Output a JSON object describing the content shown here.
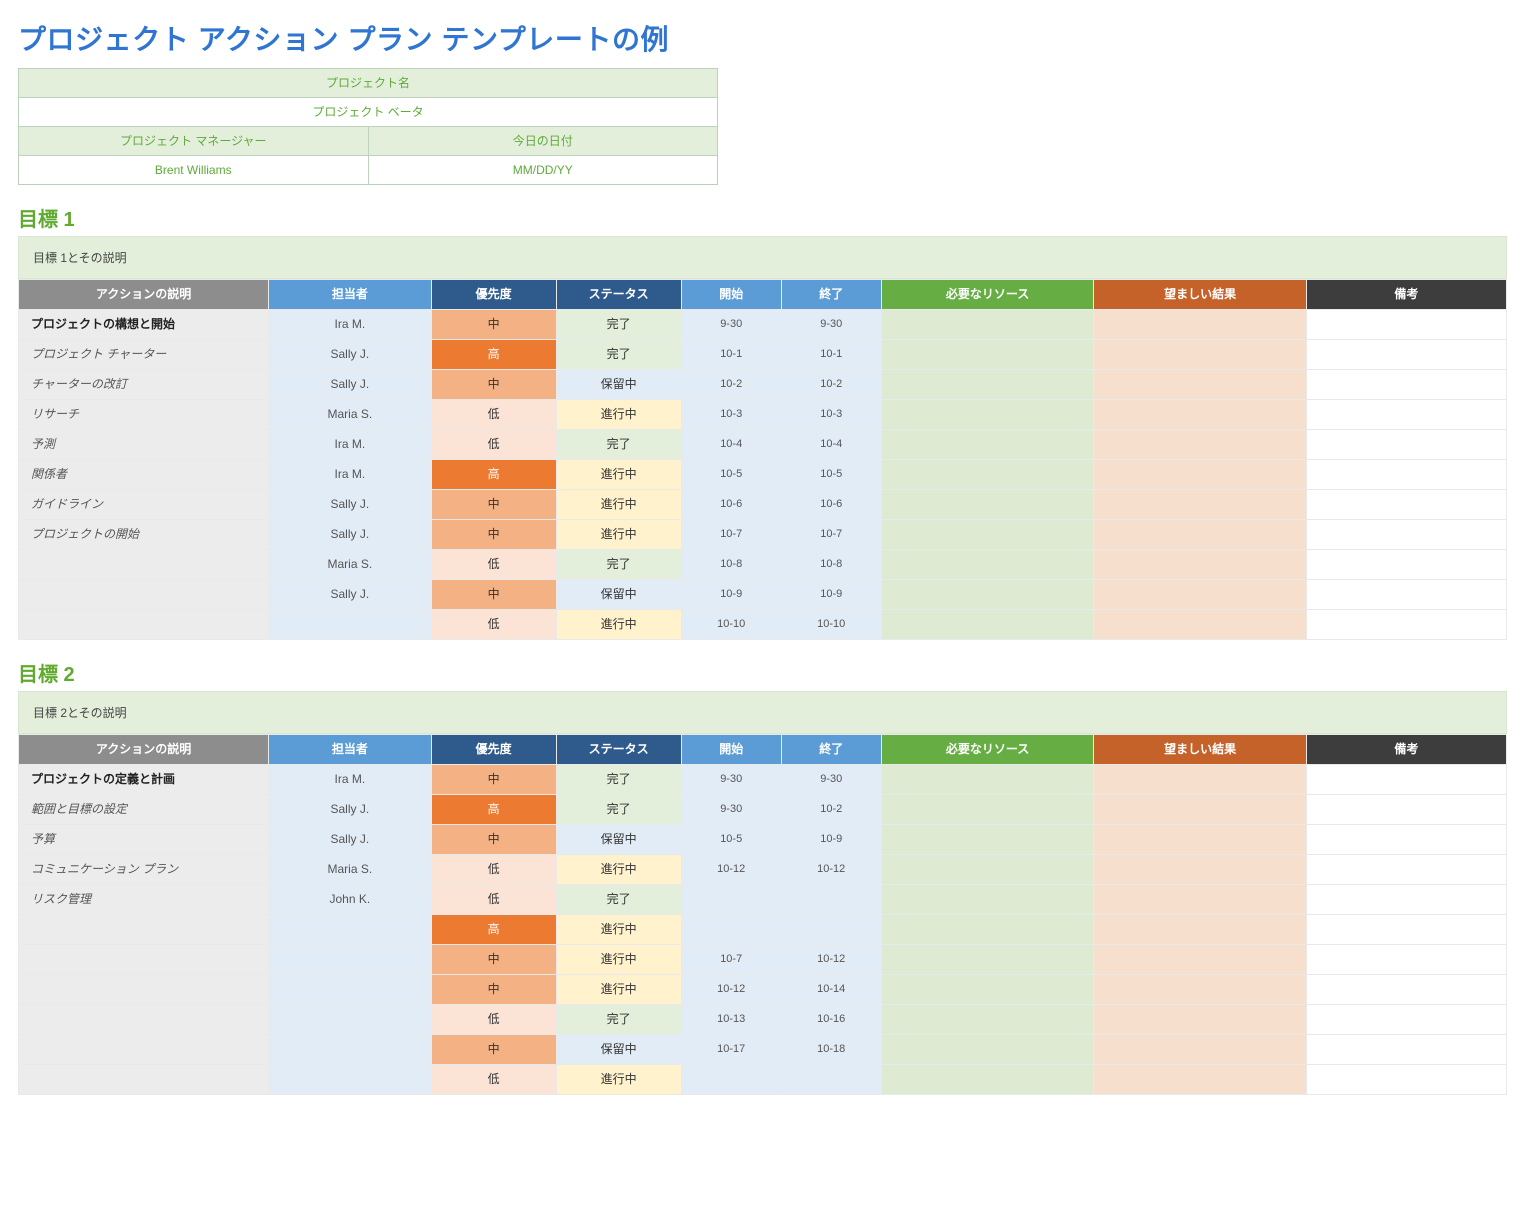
{
  "title": "プロジェクト アクション プラン テンプレートの例",
  "meta": {
    "project_label": "プロジェクト名",
    "project_value": "プロジェクト ベータ",
    "manager_label": "プロジェクト マネージャー",
    "manager_value": "Brent Williams",
    "date_label": "今日の日付",
    "date_value": "MM/DD/YY"
  },
  "columns": {
    "action": "アクションの説明",
    "owner": "担当者",
    "priority": "優先度",
    "status": "ステータス",
    "start": "開始",
    "end": "終了",
    "resource": "必要なリソース",
    "result": "望ましい結果",
    "note": "備考"
  },
  "priority_labels": {
    "high": "高",
    "med": "中",
    "low": "低"
  },
  "status_labels": {
    "done": "完了",
    "hold": "保留中",
    "prog": "進行中"
  },
  "goals": [
    {
      "heading": "目標 1",
      "desc": "目標 1とその説明",
      "rows": [
        {
          "action": "プロジェクトの構想と開始",
          "bold": true,
          "owner": "Ira M.",
          "priority": "med",
          "status": "done",
          "start": "9-30",
          "end": "9-30"
        },
        {
          "action": "プロジェクト チャーター",
          "owner": "Sally J.",
          "priority": "high",
          "status": "done",
          "start": "10-1",
          "end": "10-1"
        },
        {
          "action": "チャーターの改訂",
          "owner": "Sally J.",
          "priority": "med",
          "status": "hold",
          "start": "10-2",
          "end": "10-2"
        },
        {
          "action": "リサーチ",
          "owner": "Maria S.",
          "priority": "low",
          "status": "prog",
          "start": "10-3",
          "end": "10-3"
        },
        {
          "action": "予測",
          "owner": "Ira M.",
          "priority": "low",
          "status": "done",
          "start": "10-4",
          "end": "10-4"
        },
        {
          "action": "関係者",
          "owner": "Ira M.",
          "priority": "high",
          "status": "prog",
          "start": "10-5",
          "end": "10-5"
        },
        {
          "action": "ガイドライン",
          "owner": "Sally J.",
          "priority": "med",
          "status": "prog",
          "start": "10-6",
          "end": "10-6"
        },
        {
          "action": "プロジェクトの開始",
          "owner": "Sally J.",
          "priority": "med",
          "status": "prog",
          "start": "10-7",
          "end": "10-7"
        },
        {
          "action": "",
          "owner": "Maria S.",
          "priority": "low",
          "status": "done",
          "start": "10-8",
          "end": "10-8"
        },
        {
          "action": "",
          "owner": "Sally J.",
          "priority": "med",
          "status": "hold",
          "start": "10-9",
          "end": "10-9"
        },
        {
          "action": "",
          "owner": "",
          "priority": "low",
          "status": "prog",
          "start": "10-10",
          "end": "10-10"
        }
      ]
    },
    {
      "heading": "目標 2",
      "desc": "目標 2とその説明",
      "rows": [
        {
          "action": "プロジェクトの定義と計画",
          "bold": true,
          "owner": "Ira M.",
          "priority": "med",
          "status": "done",
          "start": "9-30",
          "end": "9-30"
        },
        {
          "action": "範囲と目標の設定",
          "owner": "Sally J.",
          "priority": "high",
          "status": "done",
          "start": "9-30",
          "end": "10-2"
        },
        {
          "action": "予算",
          "owner": "Sally J.",
          "priority": "med",
          "status": "hold",
          "start": "10-5",
          "end": "10-9"
        },
        {
          "action": "コミュニケーション プラン",
          "owner": "Maria S.",
          "priority": "low",
          "status": "prog",
          "start": "10-12",
          "end": "10-12"
        },
        {
          "action": "リスク管理",
          "owner": "John K.",
          "priority": "low",
          "status": "done",
          "start": "",
          "end": ""
        },
        {
          "action": "",
          "owner": "",
          "priority": "high",
          "status": "prog",
          "start": "",
          "end": ""
        },
        {
          "action": "",
          "owner": "",
          "priority": "med",
          "status": "prog",
          "start": "10-7",
          "end": "10-12"
        },
        {
          "action": "",
          "owner": "",
          "priority": "med",
          "status": "prog",
          "start": "10-12",
          "end": "10-14"
        },
        {
          "action": "",
          "owner": "",
          "priority": "low",
          "status": "done",
          "start": "10-13",
          "end": "10-16"
        },
        {
          "action": "",
          "owner": "",
          "priority": "med",
          "status": "hold",
          "start": "10-17",
          "end": "10-18"
        },
        {
          "action": "",
          "owner": "",
          "priority": "low",
          "status": "prog",
          "start": "",
          "end": ""
        }
      ]
    }
  ]
}
